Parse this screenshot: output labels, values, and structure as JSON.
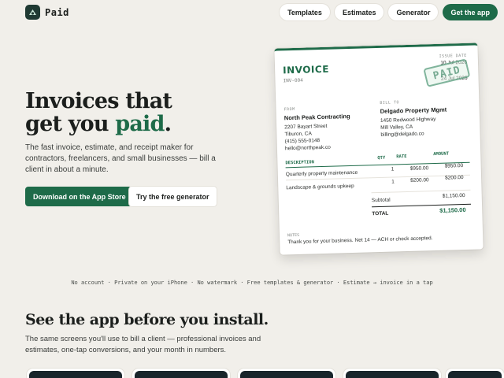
{
  "brand": {
    "name": "Paid"
  },
  "nav": {
    "links": [
      "Templates",
      "Estimates",
      "Generator"
    ],
    "cta": "Get the app"
  },
  "hero": {
    "title_line1": "Invoices that",
    "title_line2_prefix": "get you ",
    "title_line2_accent": "paid",
    "title_line2_suffix": ".",
    "subtitle": "The fast invoice, estimate, and receipt maker for contractors, freelancers, and small businesses — bill a client in about a minute.",
    "primary_button": "Download on the App Store",
    "secondary_button": "Try the free generator"
  },
  "invoice": {
    "title": "INVOICE",
    "number": "INV-004",
    "issue_label": "ISSUE DATE",
    "issue_date": "10 Jul 2026",
    "due_date": "24 Jul 2026",
    "stamp": "PAID",
    "from_label": "FROM",
    "from": {
      "name": "North Peak Contracting",
      "lines": [
        "2207 Bayart Street",
        "Tiburon, CA",
        "(415) 555-0148",
        "hello@northpeak.co"
      ]
    },
    "to_label": "BILL TO",
    "to": {
      "name": "Delgado Property Mgmt",
      "lines": [
        "1450 Redwood Highway",
        "Mill Valley, CA",
        "billing@delgado.co"
      ]
    },
    "columns": {
      "description": "DESCRIPTION",
      "qty": "QTY",
      "rate": "RATE",
      "amount": "AMOUNT"
    },
    "items": [
      {
        "description": "Quarterly property maintenance",
        "qty": "1",
        "rate": "$950.00",
        "amount": "$950.00"
      },
      {
        "description": "Landscape & grounds upkeep",
        "qty": "1",
        "rate": "$200.00",
        "amount": "$200.00"
      }
    ],
    "subtotal_label": "Subtotal",
    "subtotal": "$1,150.00",
    "total_label": "TOTAL",
    "total": "$1,150.00",
    "notes_label": "NOTES",
    "notes": "Thank you for your business. Net 14 — ACH or check accepted."
  },
  "tagline": "No account · Private on your iPhone · No watermark · Free templates & generator · Estimate → invoice in a tap",
  "section": {
    "title": "See the app before you install.",
    "subtitle": "The same screens you'll use to bill a client — professional invoices and estimates, one-tap conversions, and your month in numbers."
  },
  "colors": {
    "accent": "#1e6b49",
    "background": "#f1efea",
    "stamp": "#6aa88b"
  }
}
